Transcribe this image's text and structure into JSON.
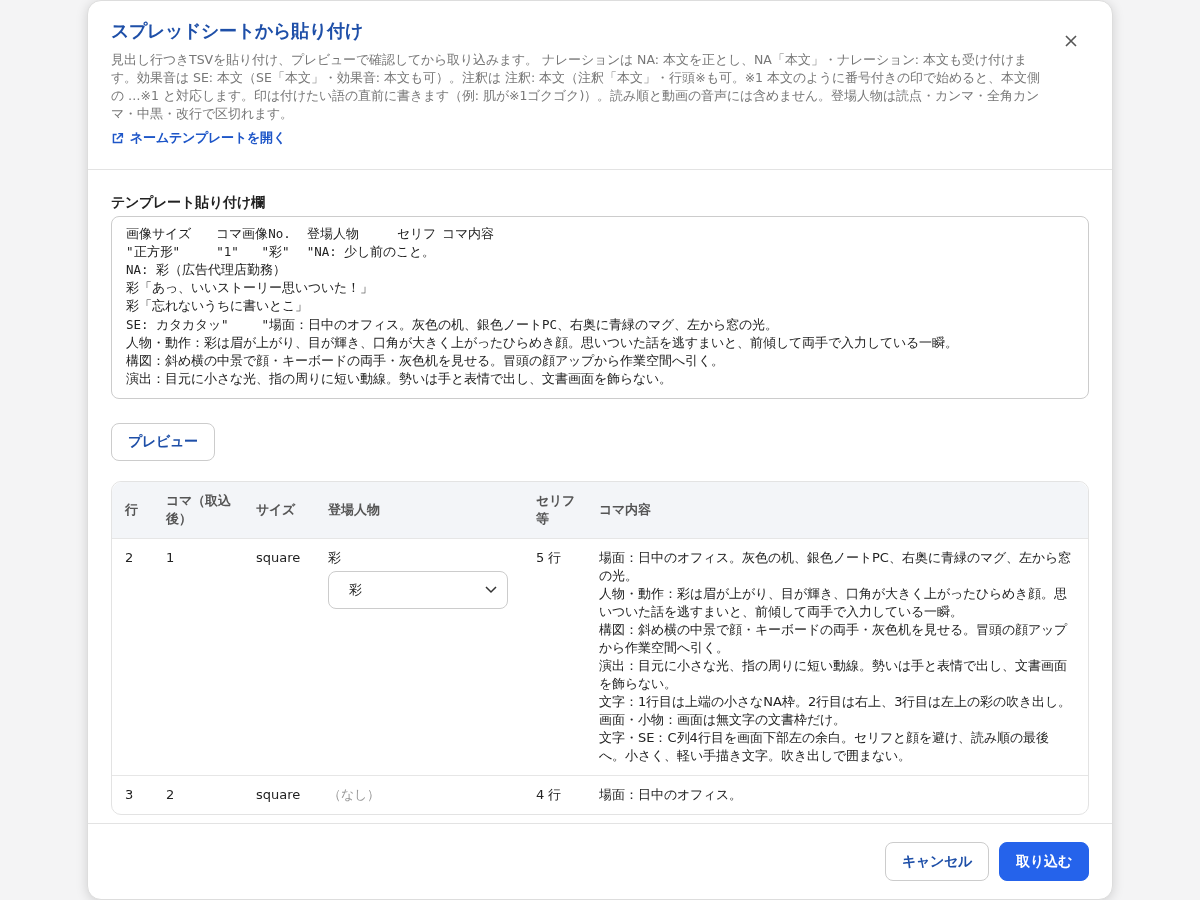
{
  "dialog": {
    "title": "スプレッドシートから貼り付け",
    "description": "見出し行つきTSVを貼り付け、プレビューで確認してから取り込みます。 ナレーションは NA: 本文を正とし、NA「本文」・ナレーション: 本文も受け付けます。効果音は SE: 本文（SE「本文」・効果音: 本文も可）。注釈は 注釈: 本文（注釈「本文」・行頭※も可。※1 本文のように番号付きの印で始めると、本文側の …※1 と対応します。印は付けたい語の直前に書きます（例: 肌が※1ゴクゴク)）。読み順と動画の音声には含めません。登場人物は読点・カンマ・全角カンマ・中黒・改行で区切れます。",
    "template_link": "ネームテンプレートを開く"
  },
  "paste_field": {
    "label": "テンプレート貼り付け欄",
    "lines": [
      "画像サイズ\tコマ画像No.\t登場人物\tセリフ\tコマ内容",
      "\"正方形\"\t\"1\"\t\"彩\"\t\"NA: 少し前のこと。",
      "NA: 彩（広告代理店勤務）",
      "彩「あっ、いいストーリー思いついた！」",
      "彩「忘れないうちに書いとこ」",
      "SE: カタカタッ\"\t\"場面：日中のオフィス。灰色の机、銀色ノートPC、右奥に青緑のマグ、左から窓の光。",
      "人物・動作：彩は眉が上がり、目が輝き、口角が大きく上がったひらめき顔。思いついた話を逃すまいと、前傾して両手で入力している一瞬。",
      "構図：斜め横の中景で顔・キーボードの両手・灰色机を見せる。冒頭の顔アップから作業空間へ引く。",
      "演出：目元に小さな光、指の周りに短い動線。勢いは手と表情で出し、文書画面を飾らない。"
    ]
  },
  "preview_button": "プレビュー",
  "table": {
    "columns": [
      "行",
      "コマ（取込後）",
      "サイズ",
      "登場人物",
      "セリフ等",
      "コマ内容"
    ],
    "rows": [
      {
        "row": "2",
        "panel": "1",
        "size": "square",
        "characters": "彩",
        "character_select": "彩",
        "lines": "5 行",
        "content": [
          "場面：日中のオフィス。灰色の机、銀色ノートPC、右奥に青緑のマグ、左から窓の光。",
          "人物・動作：彩は眉が上がり、目が輝き、口角が大きく上がったひらめき顔。思いついた話を逃すまいと、前傾して両手で入力している一瞬。",
          "構図：斜め横の中景で顔・キーボードの両手・灰色机を見せる。冒頭の顔アップから作業空間へ引く。",
          "演出：目元に小さな光、指の周りに短い動線。勢いは手と表情で出し、文書画面を飾らない。",
          "文字：1行目は上端の小さなNA枠。2行目は右上、3行目は左上の彩の吹き出し。",
          "画面・小物：画面は無文字の文書枠だけ。",
          "文字・SE：C列4行目を画面下部左の余白。セリフと顔を避け、読み順の最後へ。小さく、軽い手描き文字。吹き出しで囲まない。"
        ]
      },
      {
        "row": "3",
        "panel": "2",
        "size": "square",
        "characters": "（なし）",
        "lines": "4 行",
        "content": [
          "場面：日中のオフィス。"
        ]
      }
    ]
  },
  "buttons": {
    "cancel": "キャンセル",
    "import": "取り込む"
  }
}
